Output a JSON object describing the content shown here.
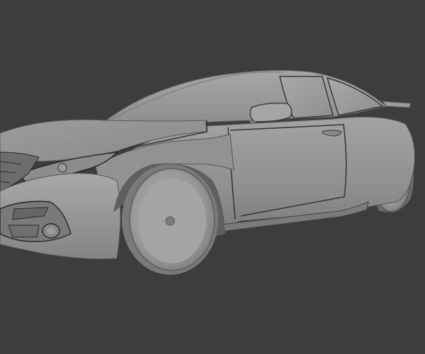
{
  "scene": {
    "background_color": "#3d3d3d",
    "model_base_color": "#9a9a9a",
    "model_shadow_color": "#6f6f6f",
    "model_highlight_color": "#b4b4b4",
    "edge_color": "#2a2a2a",
    "subject": "car-3d-model"
  }
}
